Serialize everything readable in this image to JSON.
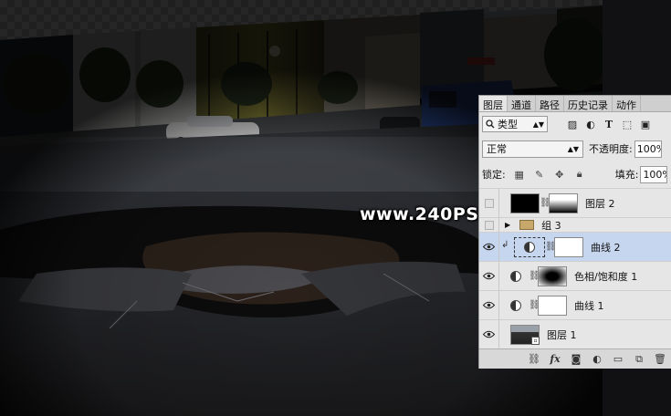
{
  "watermark": "www.240PS.com",
  "layers_panel": {
    "tabs": [
      "图层",
      "通道",
      "路径",
      "历史记录",
      "动作"
    ],
    "active_tab": "图层",
    "kind_filter": {
      "label": "类型"
    },
    "blend_mode": "正常",
    "opacity_label": "不透明度:",
    "opacity_value": "100%",
    "lock_label": "锁定:",
    "fill_label": "填充:",
    "fill_value": "100%",
    "layers": [
      {
        "name": "图层 2",
        "visible": false
      },
      {
        "name": "组 3",
        "visible": false
      },
      {
        "name": "曲线 2",
        "visible": true,
        "selected": true,
        "clipped": true
      },
      {
        "name": "色相/饱和度 1",
        "visible": true
      },
      {
        "name": "曲线 1",
        "visible": true
      },
      {
        "name": "图层 1",
        "visible": true
      }
    ]
  },
  "colors": {
    "panel_bg": "#e6e6e6",
    "selected_layer": "#c7d6ef",
    "tab_bar": "#cfcfcf"
  },
  "icons": {
    "kind_filter": "search-icon",
    "filters": [
      "image-filter-icon",
      "adjustment-filter-icon",
      "type-filter-icon",
      "shape-filter-icon",
      "smart-object-filter-icon"
    ],
    "locks": [
      "lock-pixels-checker-icon",
      "lock-brush-icon",
      "lock-move-icon",
      "lock-all-icon"
    ],
    "footer": [
      "link-icon",
      "fx-icon",
      "mask-icon",
      "adjustment-icon",
      "folder-icon",
      "new-layer-icon",
      "trash-icon"
    ]
  }
}
